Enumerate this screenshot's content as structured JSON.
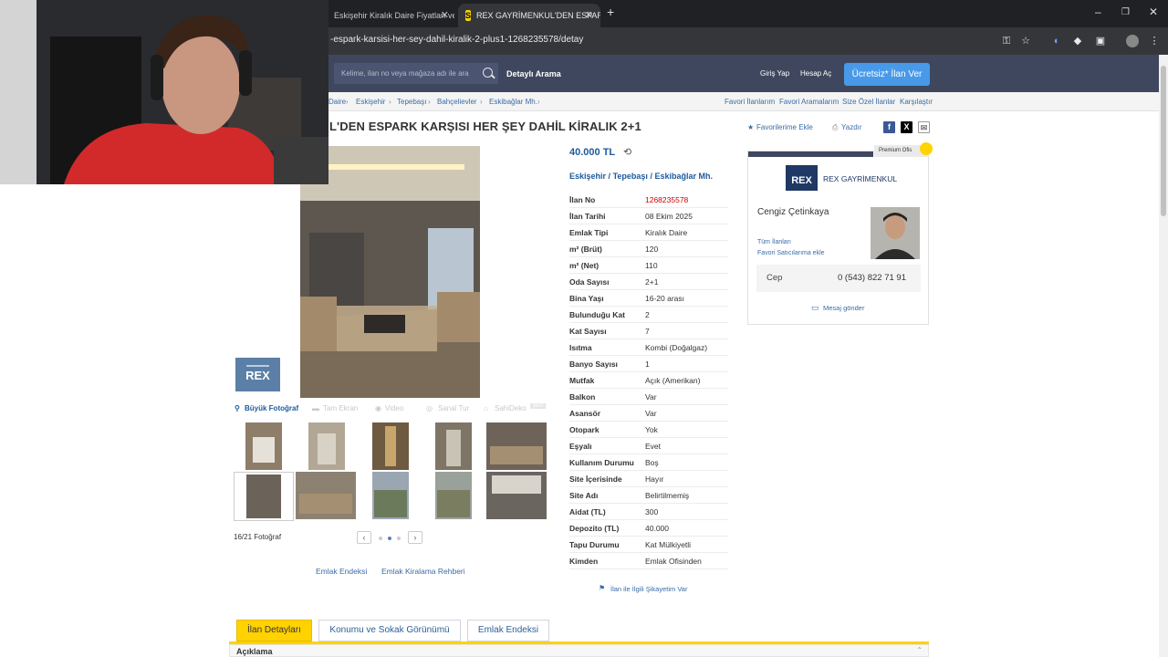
{
  "browser": {
    "tabs": [
      {
        "title": "Eskişehir Kiralık Daire Fiyatları ve",
        "active": false
      },
      {
        "title": "REX GAYRİMENKUL'DEN ESPAR",
        "active": true
      }
    ],
    "new_tab": "+",
    "url": "-espark-karsisi-her-sey-dahil-kiralik-2-plus1-1268235578/detay"
  },
  "header": {
    "search_placeholder": "Kelime, ilan no veya mağaza adı ile ara",
    "advanced_search": "Detaylı Arama",
    "login": "Giriş Yap",
    "signup": "Hesap Aç",
    "post_ad": "Ücretsiz* İlan Ver"
  },
  "breadcrumb": {
    "items": [
      "Daire",
      "Eskişehir",
      "Tepebaşı",
      "Bahçelievler",
      "Eskibağlar Mh."
    ],
    "right_links": [
      "Favori İlanlarım",
      "Favori Aramalarım",
      "Size Özel İlanlar",
      "Karşılaştır"
    ]
  },
  "listing": {
    "title": "L'DEN ESPARK KARŞISI HER ŞEY DAHİL KİRALIK 2+1",
    "add_favorite": "Favorilerime Ekle",
    "print": "Yazdır",
    "price": "40.000 TL",
    "location": [
      "Eskişehir",
      "Tepebaşı",
      "Eskibağlar Mh."
    ],
    "details": [
      {
        "key": "İlan No",
        "value": "1268235578"
      },
      {
        "key": "İlan Tarihi",
        "value": "08 Ekim 2025"
      },
      {
        "key": "Emlak Tipi",
        "value": "Kiralık Daire"
      },
      {
        "key": "m² (Brüt)",
        "value": "120"
      },
      {
        "key": "m² (Net)",
        "value": "110"
      },
      {
        "key": "Oda Sayısı",
        "value": "2+1"
      },
      {
        "key": "Bina Yaşı",
        "value": "16-20 arası"
      },
      {
        "key": "Bulunduğu Kat",
        "value": "2"
      },
      {
        "key": "Kat Sayısı",
        "value": "7"
      },
      {
        "key": "Isıtma",
        "value": "Kombi (Doğalgaz)"
      },
      {
        "key": "Banyo Sayısı",
        "value": "1"
      },
      {
        "key": "Mutfak",
        "value": "Açık (Amerikan)"
      },
      {
        "key": "Balkon",
        "value": "Var"
      },
      {
        "key": "Asansör",
        "value": "Var"
      },
      {
        "key": "Otopark",
        "value": "Yok"
      },
      {
        "key": "Eşyalı",
        "value": "Evet"
      },
      {
        "key": "Kullanım Durumu",
        "value": "Boş"
      },
      {
        "key": "Site İçerisinde",
        "value": "Hayır"
      },
      {
        "key": "Site Adı",
        "value": "Belirtilmemiş"
      },
      {
        "key": "Aidat (TL)",
        "value": "300"
      },
      {
        "key": "Depozito (TL)",
        "value": "40.000"
      },
      {
        "key": "Tapu Durumu",
        "value": "Kat Mülkiyetli"
      },
      {
        "key": "Kimden",
        "value": "Emlak Ofisinden"
      }
    ],
    "complaint": "İlan ile İlgili Şikayetim Var"
  },
  "gallery": {
    "big_photo": "Büyük Fotoğraf",
    "tabs": [
      "Tam Ekran",
      "Video",
      "Sanal Tur",
      "SahiDeko"
    ],
    "sahideko_badge": "yeni",
    "counter": "16/21 Fotoğraf",
    "prev": "‹",
    "next": "›",
    "logo_text": "REX"
  },
  "below_gallery": [
    "Emlak Endeksi",
    "Emlak Kiralama Rehberi"
  ],
  "agent": {
    "premium": "Premium Ofis",
    "company": "REX GAYRİMENKUL",
    "logo_text": "REX",
    "name": "Cengiz Çetinkaya",
    "all_ads": "Tüm İlanları",
    "add_fav_seller": "Favori Satıcılarıma ekle",
    "phone_label": "Cep",
    "phone": "0 (543) 822 71 91",
    "message": "Mesaj gönder"
  },
  "bottom_tabs": [
    "İlan Detayları",
    "Konumu ve Sokak Görünümü",
    "Emlak Endeksi"
  ],
  "description_header": "Açıklama"
}
